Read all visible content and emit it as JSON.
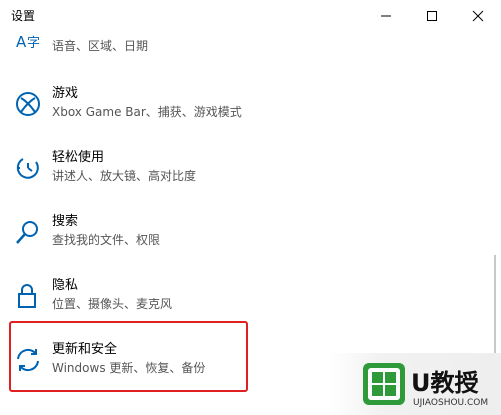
{
  "window": {
    "title": "设置"
  },
  "items": [
    {
      "label": "",
      "desc": "语音、区域、日期",
      "icon": "language-icon"
    },
    {
      "label": "游戏",
      "desc": "Xbox Game Bar、捕获、游戏模式",
      "icon": "xbox-icon"
    },
    {
      "label": "轻松使用",
      "desc": "讲述人、放大镜、高对比度",
      "icon": "ease-of-access-icon"
    },
    {
      "label": "搜索",
      "desc": "查找我的文件、权限",
      "icon": "search-icon"
    },
    {
      "label": "隐私",
      "desc": "位置、摄像头、麦克风",
      "icon": "lock-icon"
    },
    {
      "label": "更新和安全",
      "desc": "Windows 更新、恢复、备份",
      "icon": "sync-icon"
    }
  ],
  "watermark": {
    "brand": "U教授",
    "url": "UJIAOSHOU.COM"
  },
  "colors": {
    "accent": "#0063b1",
    "highlight": "#e02020"
  }
}
